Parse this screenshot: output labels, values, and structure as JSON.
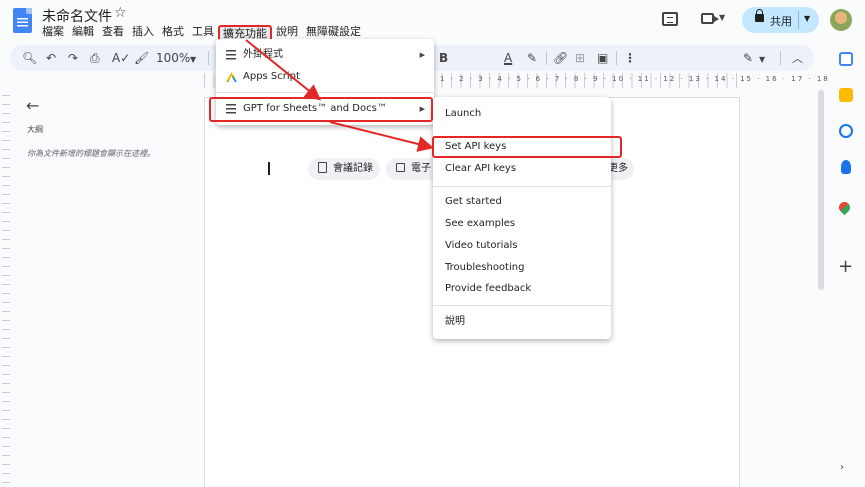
{
  "header": {
    "doc_title": "未命名文件",
    "menu": [
      "檔案",
      "編輯",
      "查看",
      "插入",
      "格式",
      "工具",
      "擴充功能",
      "說明",
      "無障礙設定"
    ],
    "active_menu_index": 6,
    "share_label": "共用"
  },
  "toolbar": {
    "zoom": "100%",
    "icons": [
      "search-icon",
      "undo-icon",
      "redo-icon",
      "print-icon",
      "spellcheck-icon",
      "paint-format-icon",
      "bold-icon",
      "text-color-icon",
      "highlight-icon",
      "link-icon",
      "comment-add-icon",
      "image-icon",
      "more-icon",
      "edit-mode-icon",
      "collapse-icon"
    ]
  },
  "ruler": {
    "numbers": "1 · 2 · 3 · 4 · 5 · 6 · 7 · 8 · 9 · 10 · 11 · 12 · 13 · 14 · 15 · 16 · 17 · 18"
  },
  "outline": {
    "label": "大綱",
    "hint": "你為文件新增的標題會顯示在這裡。"
  },
  "document": {
    "chips": [
      "會議記錄",
      "電子"
    ],
    "chip_more": "更多"
  },
  "extensions_menu": {
    "items": [
      {
        "label": "外掛程式",
        "has_submenu": true
      },
      {
        "label": "Apps Script",
        "has_submenu": false
      },
      {
        "label": "GPT for Sheets™ and Docs™",
        "has_submenu": true
      }
    ]
  },
  "gpt_submenu": {
    "items": [
      {
        "label": "Launch",
        "group": 1
      },
      {
        "label": "Set API keys",
        "group": 1
      },
      {
        "label": "Clear API keys",
        "group": 1
      },
      {
        "label": "Get started",
        "group": 2
      },
      {
        "label": "See examples",
        "group": 2
      },
      {
        "label": "Video tutorials",
        "group": 2
      },
      {
        "label": "Troubleshooting",
        "group": 2
      },
      {
        "label": "Provide feedback",
        "group": 2
      },
      {
        "label": "說明",
        "group": 3
      }
    ]
  },
  "colors": {
    "highlight_red": "#e32727",
    "share_bg": "#c2e7ff",
    "docs_blue": "#4285f4"
  }
}
